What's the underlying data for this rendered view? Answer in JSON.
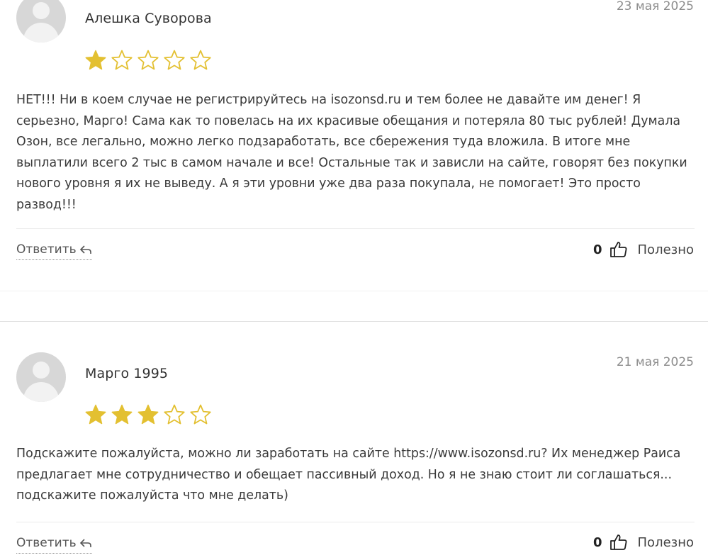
{
  "colors": {
    "star_filled": "#e3c031",
    "star_empty_stroke": "#e3c031"
  },
  "reviews": [
    {
      "author": "Алешка Суворова",
      "date": "23 мая 2025",
      "rating": 1,
      "text": "НЕТ!!! Ни в коем случае не регистрируйтесь на isozonsd.ru и тем более не давайте им денег! Я серьезно, Марго! Сама как то повелась на их красивые обещания и потеряла 80 тыс рублей! Думала Озон, все легально, можно легко подзаработать, все сбережения туда вложила. В итоге мне выплатили всего 2 тыс в самом начале и все! Остальные так и зависли на сайте, говорят без покупки нового уровня я их не выведу. А я эти уровни уже два раза покупала, не помогает! Это просто развод!!!",
      "reply_label": "Ответить",
      "helpful_count": "0",
      "helpful_label": "Полезно"
    },
    {
      "author": "Марго 1995",
      "date": "21 мая 2025",
      "rating": 3,
      "text": "Подскажите пожалуйста, можно ли заработать на сайте https://www.isozonsd.ru? Их менеджер Раиса предлагает мне сотрудничество и обещает пассивный доход. Но я не знаю стоит ли соглашаться... подскажите пожалуйста что мне делать)",
      "reply_label": "Ответить",
      "helpful_count": "0",
      "helpful_label": "Полезно"
    }
  ]
}
